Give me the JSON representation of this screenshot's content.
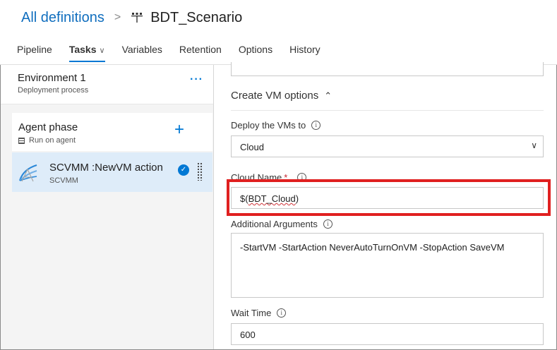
{
  "breadcrumb": {
    "parent": "All definitions",
    "separator": ">",
    "title": "BDT_Scenario"
  },
  "tabs": [
    {
      "label": "Pipeline"
    },
    {
      "label": "Tasks"
    },
    {
      "label": "Variables"
    },
    {
      "label": "Retention"
    },
    {
      "label": "Options"
    },
    {
      "label": "History"
    }
  ],
  "environment": {
    "title": "Environment 1",
    "subtitle": "Deployment process",
    "more": "···"
  },
  "phase": {
    "title": "Agent phase",
    "subtitle": "Run on agent",
    "add": "+"
  },
  "task": {
    "title": "SCVMM :NewVM action",
    "subtitle": "SCVMM",
    "check": "✓"
  },
  "section": {
    "title": "Create VM options",
    "chevron": "⌃"
  },
  "fields": {
    "deploy_label": "Deploy the VMs to",
    "deploy_value": "Cloud",
    "cloud_name_label": "Cloud Name",
    "cloud_name_required": "*",
    "cloud_name_value_prefix": "$(",
    "cloud_name_value_word": "BDT_Cloud",
    "cloud_name_value_suffix": ")",
    "args_label": "Additional Arguments",
    "args_value": "-StartVM -StartAction NeverAutoTurnOnVM -StopAction SaveVM",
    "wait_label": "Wait Time",
    "wait_value": "600",
    "info": "i"
  },
  "colors": {
    "accent": "#0078d4",
    "link": "#106ebe",
    "highlight": "#e02020",
    "selected_task_bg": "#deecf9"
  },
  "icons": {
    "pipeline": "pipeline-icon",
    "server": "server-icon",
    "task": "scvmm-icon",
    "info": "info-icon",
    "dropdown": "chevron-down-icon"
  }
}
